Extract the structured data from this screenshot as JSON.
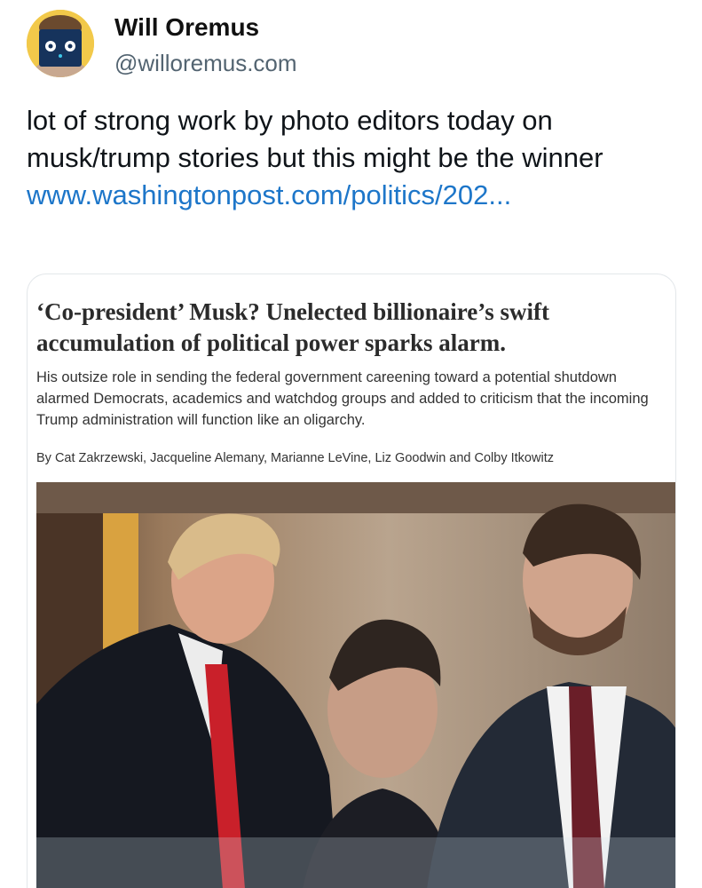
{
  "author": {
    "name": "Will Oremus",
    "handle": "@willoremus.com",
    "avatar_icon": "robot-face-avatar-icon"
  },
  "post": {
    "text": "lot of strong work by photo editors today on musk/trump stories but this might be the winner ",
    "link_text": "www.washingtonpost.com/politics/202..."
  },
  "link_card": {
    "headline": "‘Co-president’ Musk? Unelected billionaire’s swift accumulation of political power sparks alarm.",
    "deck": "His outsize role in sending the federal government careening toward a potential shutdown alarmed Democrats, academics and watchdog groups and added to criticism that the incoming Trump administration will function like an oligarchy.",
    "byline": "By Cat Zakrzewski, Jacqueline Alemany, Marianne LeVine, Liz Goodwin and Colby Itkowitz"
  },
  "colors": {
    "link": "#1d76c9",
    "handle": "#536471",
    "avatar_bg": "#f2c94a",
    "card_border": "#e3e7ea"
  }
}
